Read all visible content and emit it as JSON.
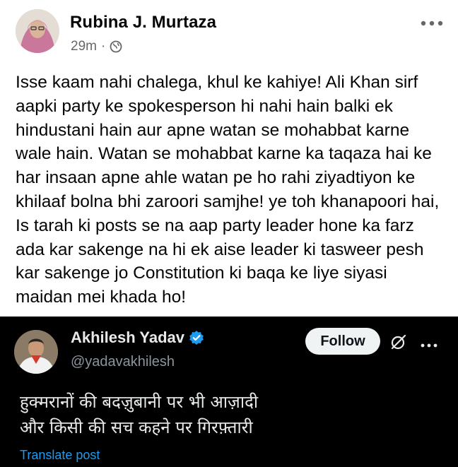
{
  "post": {
    "author": "Rubina J. Murtaza",
    "time": "29m",
    "separator": "·",
    "privacy_icon": "globe-icon",
    "menu_icon": "more-horizontal-icon",
    "text": "Isse kaam nahi chalega, khul ke kahiye! Ali Khan sirf aapki party ke spokesperson hi nahi hain balki ek hindustani hain aur apne watan se mohabbat karne wale hain. Watan se mohabbat karne ka taqaza hai ke har insaan apne ahle watan pe ho rahi ziyadtiyon ke khilaaf bolna bhi zaroori samjhe! ye toh khanapoori hai, Is tarah ki posts se na aap party leader hone ka farz ada kar sakenge na hi ek aise leader ki tasweer pesh kar sakenge jo Constitution ki baqa ke liye siyasi maidan mei khada ho!"
  },
  "embed": {
    "name": "Akhilesh Yadav",
    "handle": "@yadavakhilesh",
    "follow_label": "Follow",
    "verified_icon": "verified-badge-icon",
    "lines": [
      "हुक्मरानों की बदज़ुबानी पर भी आज़ादी",
      "और किसी की सच कहने पर गिरफ़्तारी"
    ],
    "translate_label": "Translate post"
  },
  "colors": {
    "meta_gray": "#65676b",
    "embed_bg": "#000000",
    "link_blue": "#1d9bf0",
    "verified_blue": "#1d9bf0"
  }
}
